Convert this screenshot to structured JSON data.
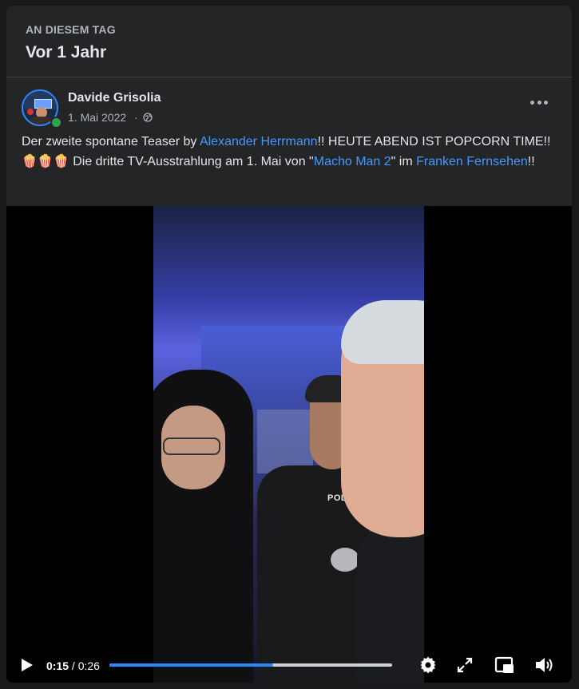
{
  "header": {
    "eyebrow": "AN DIESEM TAG",
    "title": "Vor 1 Jahr"
  },
  "post": {
    "author": "Davide Grisolia",
    "date": "1. Mai 2022",
    "separator": "·",
    "privacy_icon": "globe-icon",
    "more_icon": "more-horizontal-icon",
    "text_parts": {
      "t1": "Der zweite spontane Teaser by ",
      "link1": "Alexander Herrmann",
      "t2": "!! HEUTE ABEND IST POPCORN TIME!! ",
      "emoji": "🍿🍿🍿",
      "t3": " Die dritte TV-Ausstrahlung am 1. Mai von \"",
      "link2": "Macho Man 2",
      "t4": "\" im ",
      "link3": "Franken Fernsehen",
      "t5": "!!"
    },
    "link_color": "#4599ff"
  },
  "video": {
    "current_time": "0:15",
    "time_separator": " / ",
    "duration": "0:26",
    "progress": 0.58,
    "overlay_text": "POLIZEI",
    "icons": [
      "play-icon",
      "settings-icon",
      "fullscreen-icon",
      "picture-in-picture-icon",
      "volume-icon"
    ],
    "accent": "#2d88ff"
  }
}
